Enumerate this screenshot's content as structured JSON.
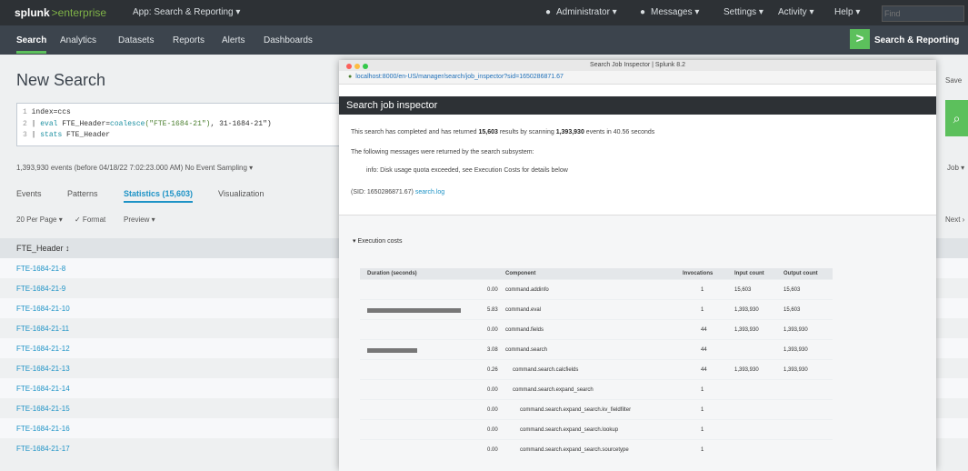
{
  "topbar": {
    "logo": "splunk",
    "logo_suffix": ">enterprise",
    "app_selector": "App: Search & Reporting ▾",
    "nav": [
      "Administrator ▾",
      "Messages ▾",
      "Settings ▾",
      "Activity ▾",
      "Help ▾"
    ],
    "find_placeholder": "Find"
  },
  "appbar": {
    "tabs": [
      "Search",
      "Analytics",
      "Datasets",
      "Reports",
      "Alerts",
      "Dashboards"
    ],
    "app_badge": ">",
    "app_name": "Search & Reporting"
  },
  "search": {
    "title": "New Search",
    "query_lines": [
      {
        "num": "1",
        "text": "index=ccs"
      },
      {
        "num": "2",
        "pipe": "| ",
        "kw": "eval",
        "rest": " FTE_Header=",
        "kw2": "coalesce",
        "str": "(\"FTE-1684-21\")",
        "rest2": ", 31-1684-21\")"
      },
      {
        "num": "3",
        "pipe": "| ",
        "kw": "stats",
        "rest": " FTE_Header"
      }
    ],
    "status": "1,393,930 events (before 04/18/22 7:02:23.000 AM)  No Event Sampling ▾",
    "tabs": [
      "Events",
      "Patterns",
      "Statistics (15,603)",
      "Visualization"
    ],
    "active_tab": 2,
    "options": [
      "20 Per Page ▾",
      "✓ Format",
      "Preview ▾"
    ],
    "column_header": "FTE_Header ↕",
    "rows": [
      "FTE-1684-21-8",
      "FTE-1684-21-9",
      "FTE-1684-21-10",
      "FTE-1684-21-11",
      "FTE-1684-21-12",
      "FTE-1684-21-13",
      "FTE-1684-21-14",
      "FTE-1684-21-15",
      "FTE-1684-21-16",
      "FTE-1684-21-17"
    ],
    "right_fragments": {
      "job": "Job ▾",
      "next": "Next ›",
      "save": "Save"
    }
  },
  "inspector": {
    "window_title": "Search Job Inspector | Splunk 8.2",
    "url": "localhost:8000/en-US/manager/search/job_inspector?sid=1650286871.67",
    "header": "Search job inspector",
    "summary_prefix": "This search has completed and has returned ",
    "summary_results": "15,603",
    "summary_mid": " results by scanning ",
    "summary_events": "1,393,930",
    "summary_suffix": " events in 40.56 seconds",
    "messages_intro": "The following messages were returned by the search subsystem:",
    "message": "info: Disk usage quota exceeded, see Execution Costs for details below",
    "sid_prefix": "(SID: 1650286871.67) ",
    "sid_link": "search.log",
    "exec_costs_label": "▾ Execution costs",
    "cost_columns": [
      "Duration (seconds)",
      "",
      "Component",
      "Invocations",
      "Input count",
      "Output count"
    ],
    "cost_rows": [
      {
        "bar": 0,
        "dur": "0.00",
        "comp": "command.addinfo",
        "inv": "1",
        "in": "15,603",
        "out": "15,603"
      },
      {
        "bar": 0.86,
        "dur": "5.83",
        "comp": "command.eval",
        "inv": "1",
        "in": "1,393,930",
        "out": "15,603"
      },
      {
        "bar": 0,
        "dur": "0.00",
        "comp": "command.fields",
        "inv": "44",
        "in": "1,393,930",
        "out": "1,393,930"
      },
      {
        "bar": 0.46,
        "dur": "3.08",
        "comp": "command.search",
        "inv": "44",
        "in": "",
        "out": "1,393,930"
      },
      {
        "bar": 0,
        "dur": "0.26",
        "comp": "command.search.calcfields",
        "inv": "44",
        "in": "1,393,930",
        "out": "1,393,930"
      },
      {
        "bar": 0,
        "dur": "0.00",
        "comp": "command.search.expand_search",
        "inv": "1",
        "in": "",
        "out": ""
      },
      {
        "bar": 0,
        "dur": "0.00",
        "comp": "command.search.expand_search.kv_fieldfilter",
        "inv": "1",
        "in": "",
        "out": ""
      },
      {
        "bar": 0,
        "dur": "0.00",
        "comp": "command.search.expand_search.lookup",
        "inv": "1",
        "in": "",
        "out": ""
      },
      {
        "bar": 0,
        "dur": "0.00",
        "comp": "command.search.expand_search.sourcetype",
        "inv": "1",
        "in": "",
        "out": ""
      }
    ]
  },
  "colors": {
    "accent_green": "#5cc05c",
    "link_blue": "#1e93c6",
    "topbar": "#2d3135"
  }
}
